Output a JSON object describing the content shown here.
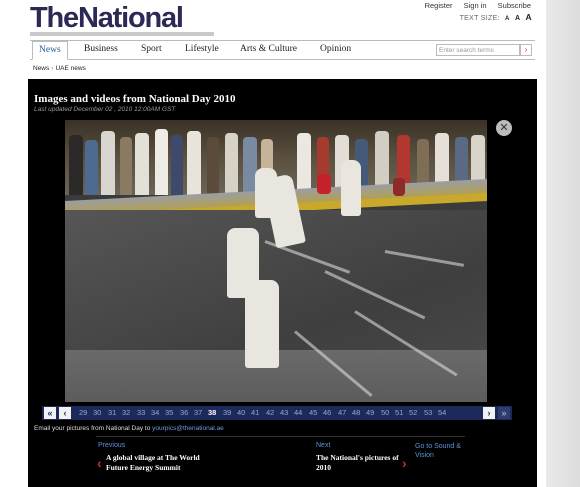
{
  "header": {
    "logo_the": "The",
    "logo_national": "National",
    "links": [
      "Register",
      "Sign in",
      "Subscribe"
    ],
    "text_size_label": "TEXT SIZE:",
    "text_size_options": [
      "A",
      "A",
      "A"
    ]
  },
  "nav": {
    "items": [
      "News",
      "Business",
      "Sport",
      "Lifestyle",
      "Arts & Culture",
      "Opinion"
    ],
    "active": "News",
    "search_placeholder": "Enter search terms",
    "search_button": "›"
  },
  "breadcrumb": [
    "News",
    "UAE news"
  ],
  "gallery": {
    "title": "Images and videos from National Day 2010",
    "updated": "Last updated December 02 , 2010 12:00AM GST",
    "close_label": "✕",
    "pager": {
      "first": "«",
      "prev": "‹",
      "next": "›",
      "last": "»",
      "pages": [
        "29",
        "30",
        "31",
        "32",
        "33",
        "34",
        "35",
        "36",
        "37",
        "38",
        "39",
        "40",
        "41",
        "42",
        "43",
        "44",
        "45",
        "46",
        "47",
        "48",
        "49",
        "50",
        "51",
        "52",
        "53",
        "54"
      ],
      "current": "38"
    },
    "email_text": "Email your pictures from National Day to ",
    "email_link": "yourpics@thenational.ae",
    "previous": {
      "label": "Previous",
      "title": "A global village at The World Future Energy Summit"
    },
    "next": {
      "label": "Next",
      "title": "The National's pictures of 2010"
    },
    "goto": "Go to Sound & Vision"
  },
  "colors": {
    "brand": "#2b2a55",
    "link": "#5b95d9",
    "arrow": "#d12a2a",
    "pager_bg": "#1b2a5a"
  }
}
